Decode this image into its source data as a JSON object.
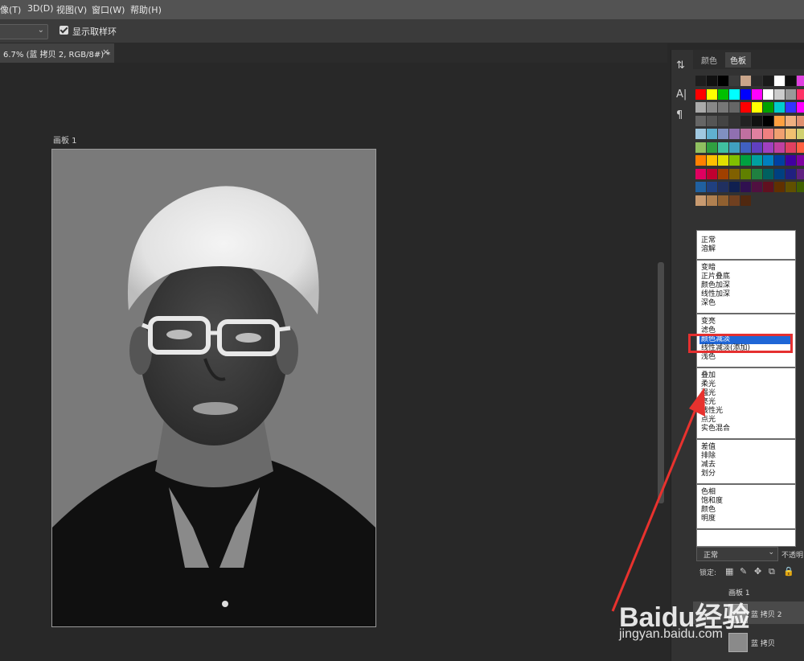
{
  "menu": [
    "像(T)",
    "3D(D)",
    "视图(V)",
    "窗口(W)",
    "帮助(H)"
  ],
  "options": {
    "show_ring_label": "显示取样环"
  },
  "document_tab": {
    "title": "6.7% (蓝 拷贝 2, RGB/8#) *",
    "close": "×"
  },
  "artboard": {
    "label": "画板 1"
  },
  "swatch_panel": {
    "tabs": [
      "颜色",
      "色板"
    ],
    "active_tab": "色板",
    "swatch_rows": [
      [
        "#1e1e1e",
        "#111111",
        "#000000",
        "#3b3b3b",
        "#c9a58a",
        "#2a2a2a",
        "#1a1a1a",
        "#ffffff",
        "#0e0e0e",
        "#e040e0",
        "#ff60ff"
      ],
      [
        "#ff0000",
        "#ffff00",
        "#00c000",
        "#00ffff",
        "#0000ff",
        "#ff00ff",
        "#ffffff",
        "#cccccc",
        "#999999",
        "#ff3366",
        "#ff99cc"
      ],
      [
        "#aaaaaa",
        "#888888",
        "#777777",
        "#666666",
        "#ff0000",
        "#ffff00",
        "#00a000",
        "#00cccc",
        "#3333ff",
        "#ff00ff",
        "#bbbbbb"
      ],
      [
        "#666666",
        "#555555",
        "#444444",
        "#333333",
        "#222222",
        "#111111",
        "#000000",
        "#ffa040",
        "#f0b080",
        "#e09070",
        "#d8a080"
      ],
      [
        "#a0c8e0",
        "#60b0d0",
        "#8090c0",
        "#9070b0",
        "#c070a0",
        "#e080a0",
        "#f08080",
        "#f0a070",
        "#f0c070",
        "#d0d070",
        "#a0d070"
      ],
      [
        "#90c060",
        "#30a040",
        "#40c0a0",
        "#40a0c0",
        "#4060c0",
        "#6040c0",
        "#a040c0",
        "#c040a0",
        "#e04060",
        "#ff6040",
        "#ffa030"
      ],
      [
        "#ff8000",
        "#ffc000",
        "#e0e000",
        "#80c000",
        "#00a040",
        "#00a0a0",
        "#0080c0",
        "#0040a0",
        "#4000a0",
        "#8000a0",
        "#a00060"
      ],
      [
        "#e00060",
        "#c00030",
        "#a04000",
        "#806000",
        "#608000",
        "#208040",
        "#006060",
        "#004080",
        "#202080",
        "#602080",
        "#802040"
      ],
      [
        "#2060a0",
        "#204080",
        "#203060",
        "#102050",
        "#301050",
        "#501040",
        "#601020",
        "#603000",
        "#605000",
        "#406000",
        "#206030"
      ],
      [
        "#c89a70",
        "#b08050",
        "#906030",
        "#704020",
        "#502810"
      ]
    ]
  },
  "blend_groups": [
    [
      "正常",
      "溶解"
    ],
    [
      "变暗",
      "正片叠底",
      "颜色加深",
      "线性加深",
      "深色"
    ],
    [
      "变亮",
      "滤色",
      "颜色减淡",
      "线性减淡(添加)",
      "浅色"
    ],
    [
      "叠加",
      "柔光",
      "强光",
      "亮光",
      "线性光",
      "点光",
      "实色混合"
    ],
    [
      "差值",
      "排除",
      "减去",
      "划分"
    ],
    [
      "色相",
      "饱和度",
      "颜色",
      "明度"
    ]
  ],
  "blend_selected": "颜色减淡",
  "blend_mode_value": "正常",
  "opacity_label": "不透明",
  "lock_label": "锁定:",
  "layers": [
    {
      "name": "画板 1"
    },
    {
      "name": "蓝 拷贝 2"
    },
    {
      "name": "蓝 拷贝"
    }
  ],
  "watermark": {
    "logo": "Baidu经验",
    "url": "jingyan.baidu.com"
  },
  "colors": {
    "highlight_red": "#e53030",
    "selection_blue": "#1f66d6",
    "arrow_red": "#e8322e"
  }
}
